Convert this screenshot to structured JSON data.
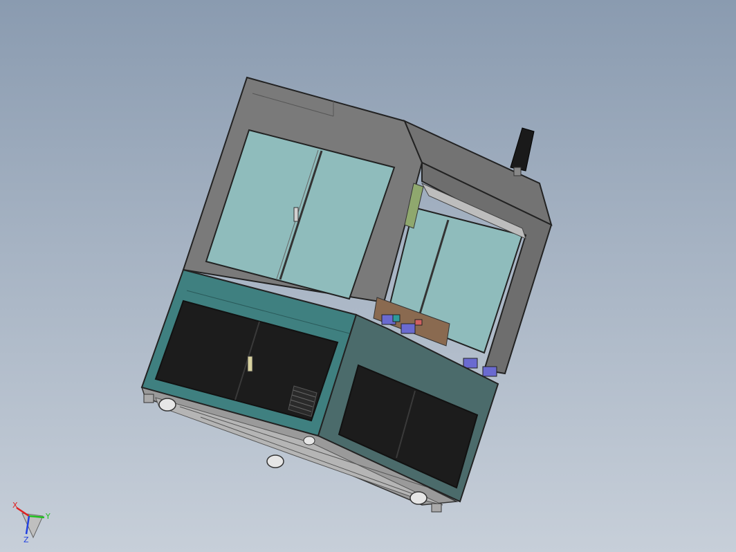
{
  "viewport": {
    "background_top": "#8a9bb0",
    "background_bottom": "#c7cfd9"
  },
  "model": {
    "frame_color": "#7a7a7a",
    "glass_color": "#8fbcbc",
    "cabinet_color": "#3f8080",
    "door_color": "#1c1c1c",
    "side_panel_color": "#4b6b6b"
  },
  "triad": {
    "x_label": "X",
    "y_label": "Y",
    "z_label": "Z",
    "x_color": "#e02020",
    "y_color": "#20c020",
    "z_color": "#2040e0"
  }
}
